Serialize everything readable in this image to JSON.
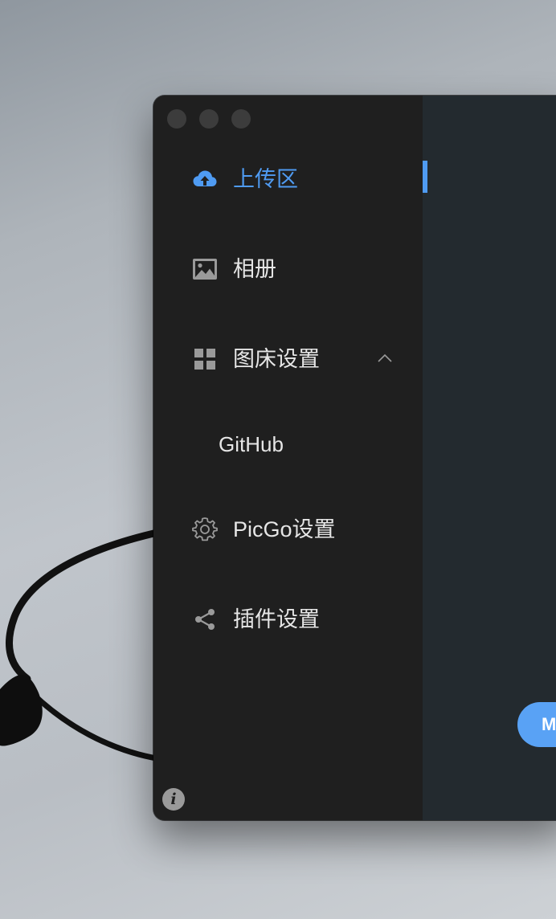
{
  "window": {
    "controls": [
      "close",
      "minimize",
      "zoom"
    ]
  },
  "sidebar": {
    "items": [
      {
        "label": "上传区",
        "icon": "cloud-upload-icon",
        "active": true
      },
      {
        "label": "相册",
        "icon": "image-icon",
        "active": false
      },
      {
        "label": "图床设置",
        "icon": "grid-icon",
        "active": false,
        "expanded": true,
        "children": [
          {
            "label": "GitHub"
          }
        ]
      },
      {
        "label": "PicGo设置",
        "icon": "gear-icon",
        "active": false
      },
      {
        "label": "插件设置",
        "icon": "share-icon",
        "active": false
      }
    ],
    "info_icon": "i"
  },
  "main": {
    "button_label": "M"
  },
  "colors": {
    "accent": "#4f9bf2",
    "sidebar_bg": "#1f1f1f",
    "main_bg": "#232a2f",
    "text": "#e6e6e6",
    "icon": "#9a9a9a"
  }
}
